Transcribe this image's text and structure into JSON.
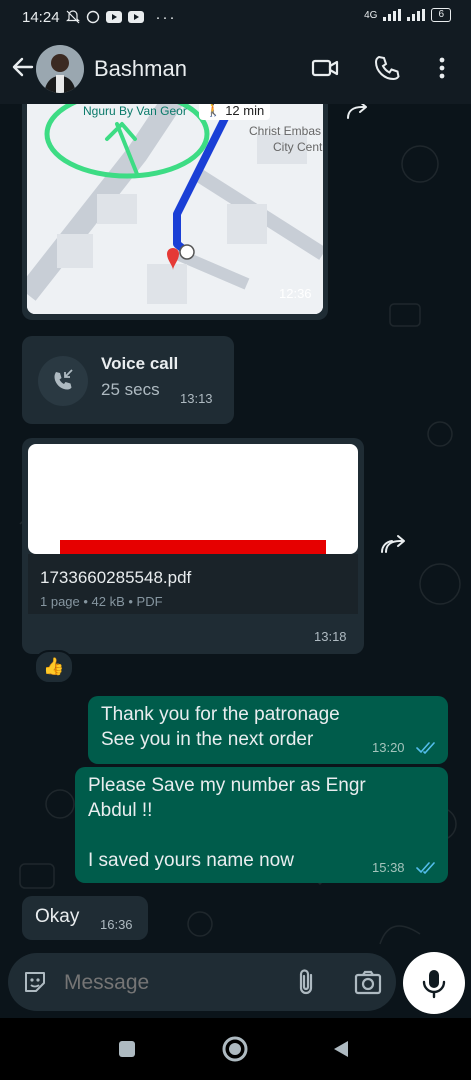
{
  "status_bar": {
    "time": "14:24",
    "network": "4G",
    "battery": "6"
  },
  "header": {
    "contact_name": "Bashman"
  },
  "messages": {
    "map": {
      "place_label": "Nguru By Van Geor",
      "walk_time": "12 min",
      "street_label_1": "Christ Embas",
      "street_label_2": "City Cent",
      "time": "12:36"
    },
    "voice_call": {
      "title": "Voice call",
      "duration": "25 secs",
      "time": "13:13"
    },
    "document": {
      "file_name": "1733660285548.pdf",
      "meta": "1 page • 42 kB • PDF",
      "time": "13:18",
      "reaction": "👍"
    },
    "out_1": {
      "text": "Thank you for the patronage\nSee you in the next order",
      "time": "13:20"
    },
    "out_2": {
      "text": "Please Save my number as Engr Abdul !!\n\nI saved yours name now",
      "time": "15:38"
    },
    "in_okay": {
      "text": "Okay",
      "time": "16:36"
    }
  },
  "composer": {
    "placeholder": "Message"
  },
  "colors": {
    "background": "#0b141a",
    "incoming_bubble": "#1f2c34",
    "outgoing_bubble": "#005c4b",
    "read_ticks": "#53bdeb",
    "map_route": "#1a3fd6",
    "annotation_green": "#3ddc84"
  }
}
